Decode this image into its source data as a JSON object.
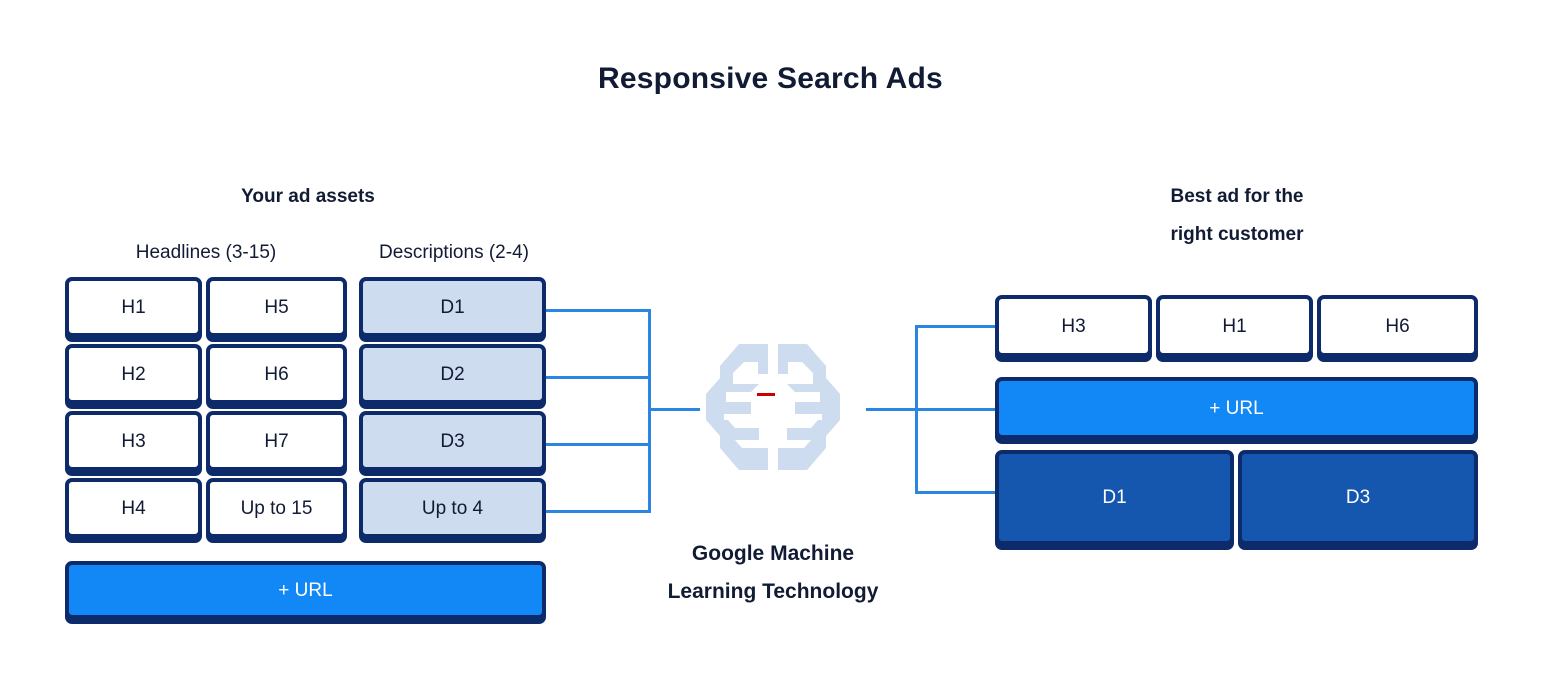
{
  "title": "Responsive Search Ads",
  "left_panel": {
    "heading": "Your ad assets",
    "headlines_label": "Headlines (3-15)",
    "descriptions_label": "Descriptions (2-4)",
    "headlines_col1": [
      "H1",
      "H2",
      "H3",
      "H4"
    ],
    "headlines_col2": [
      "H5",
      "H6",
      "H7",
      "Up to 15"
    ],
    "descriptions": [
      "D1",
      "D2",
      "D3",
      "Up to 4"
    ],
    "url_button": "+ URL"
  },
  "center": {
    "icon": "brain-icon",
    "caption_line1": "Google Machine",
    "caption_line2": "Learning Technology"
  },
  "right_panel": {
    "heading_line1": "Best ad for the",
    "heading_line2": "right customer",
    "headlines": [
      "H3",
      "H1",
      "H6"
    ],
    "url_button": "+ URL",
    "descriptions": [
      "D1",
      "D3"
    ]
  },
  "colors": {
    "navy_border": "#0d2a6b",
    "dark_text": "#111b34",
    "light_blue_fill": "#cedcef",
    "bright_blue": "#1188f5",
    "mid_blue": "#1556ae",
    "connector_blue": "#2a86e0",
    "brain_fill": "#cedcef",
    "accent_red": "#cc0000"
  }
}
